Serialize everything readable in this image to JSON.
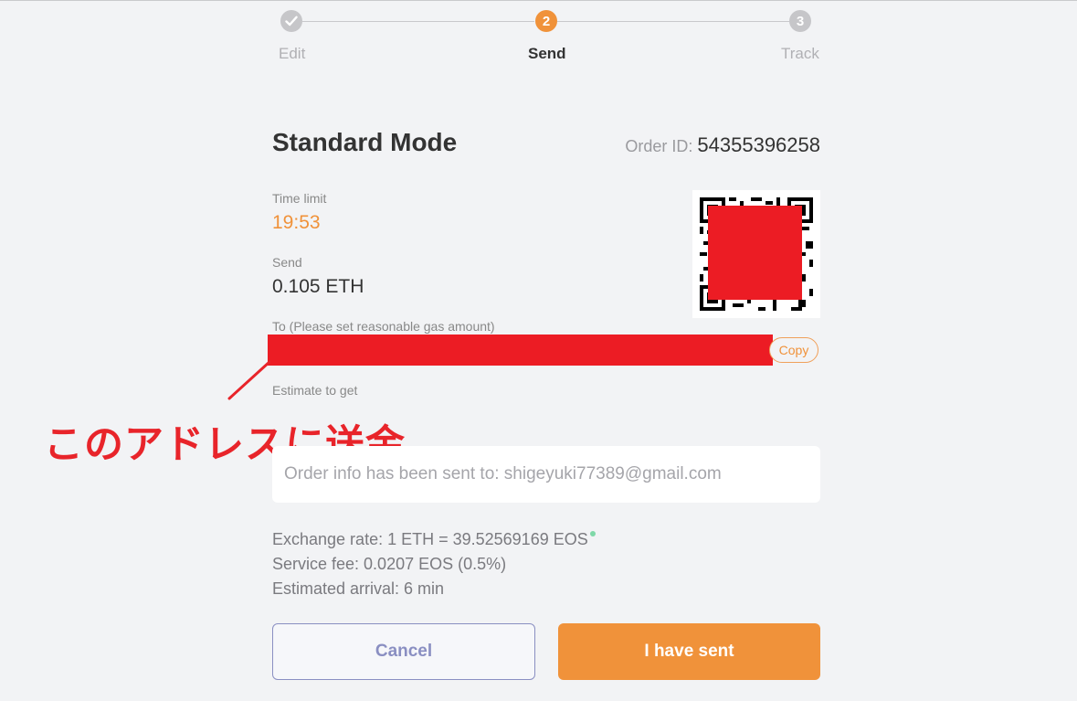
{
  "stepper": {
    "steps": [
      {
        "number": "1",
        "label": "Edit",
        "state": "done"
      },
      {
        "number": "2",
        "label": "Send",
        "state": "active"
      },
      {
        "number": "3",
        "label": "Track",
        "state": "todo"
      }
    ]
  },
  "header": {
    "title": "Standard Mode",
    "order_id_label": "Order ID:",
    "order_id_value": "54355396258"
  },
  "time_limit": {
    "label": "Time limit",
    "value": "19:53"
  },
  "send": {
    "label": "Send",
    "value": "0.105 ETH"
  },
  "to": {
    "label": "To (Please set reasonable gas amount)",
    "copy_label": "Copy"
  },
  "estimate": {
    "label": "Estimate to get"
  },
  "annotation": {
    "text": "このアドレスに送金"
  },
  "info_box": {
    "text": "Order info has been sent to: shigeyuki77389@gmail.com"
  },
  "meta": {
    "exchange_rate": "Exchange rate: 1 ETH = 39.52569169 EOS",
    "service_fee": "Service fee: 0.0207 EOS (0.5%)",
    "arrival": "Estimated arrival: 6 min"
  },
  "buttons": {
    "cancel": "Cancel",
    "sent": "I have sent"
  },
  "colors": {
    "accent": "#f0923a",
    "redaction": "#ec1c24",
    "cancel_border": "#8a8fc2",
    "live_dot": "#7fd8a8"
  },
  "icons": {
    "done_step": "check-icon",
    "rate_status": "status-dot-icon"
  }
}
